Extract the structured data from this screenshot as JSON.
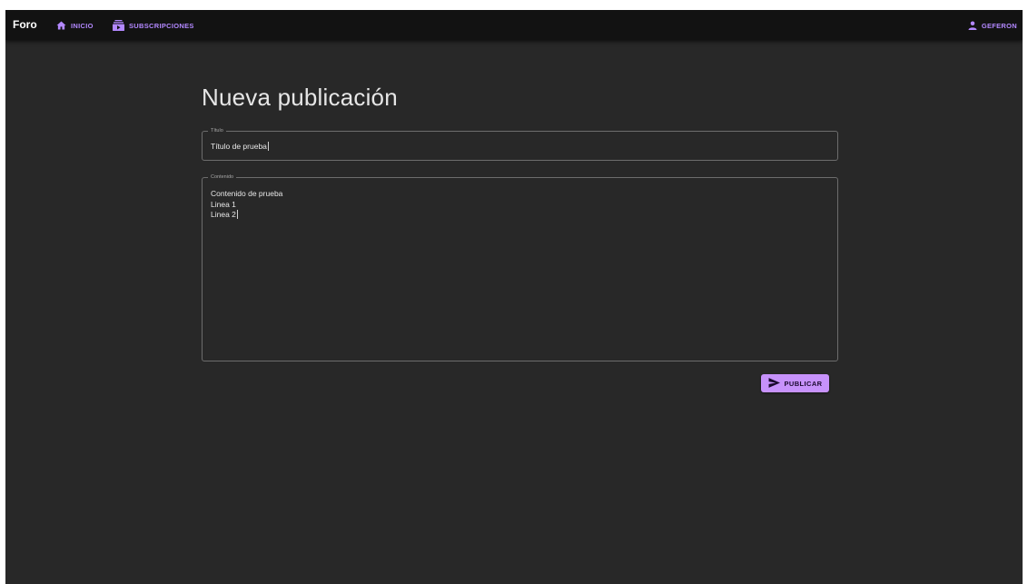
{
  "navbar": {
    "brand": "Foro",
    "home_label": "INICIO",
    "subscriptions_label": "SUBSCRIPCIONES",
    "user_label": "GEFERON"
  },
  "page": {
    "title": "Nueva publicación"
  },
  "form": {
    "title_field": {
      "label": "Título",
      "value": "Título de prueba"
    },
    "content_field": {
      "label": "Contenido",
      "value": "Contenido de prueba\nLinea 1\nLinea 2"
    },
    "submit_label": "PUBLICAR"
  },
  "colors": {
    "accent": "#b388ff",
    "button_bg": "#c792fb",
    "background": "#282828",
    "topbar": "#121212"
  }
}
